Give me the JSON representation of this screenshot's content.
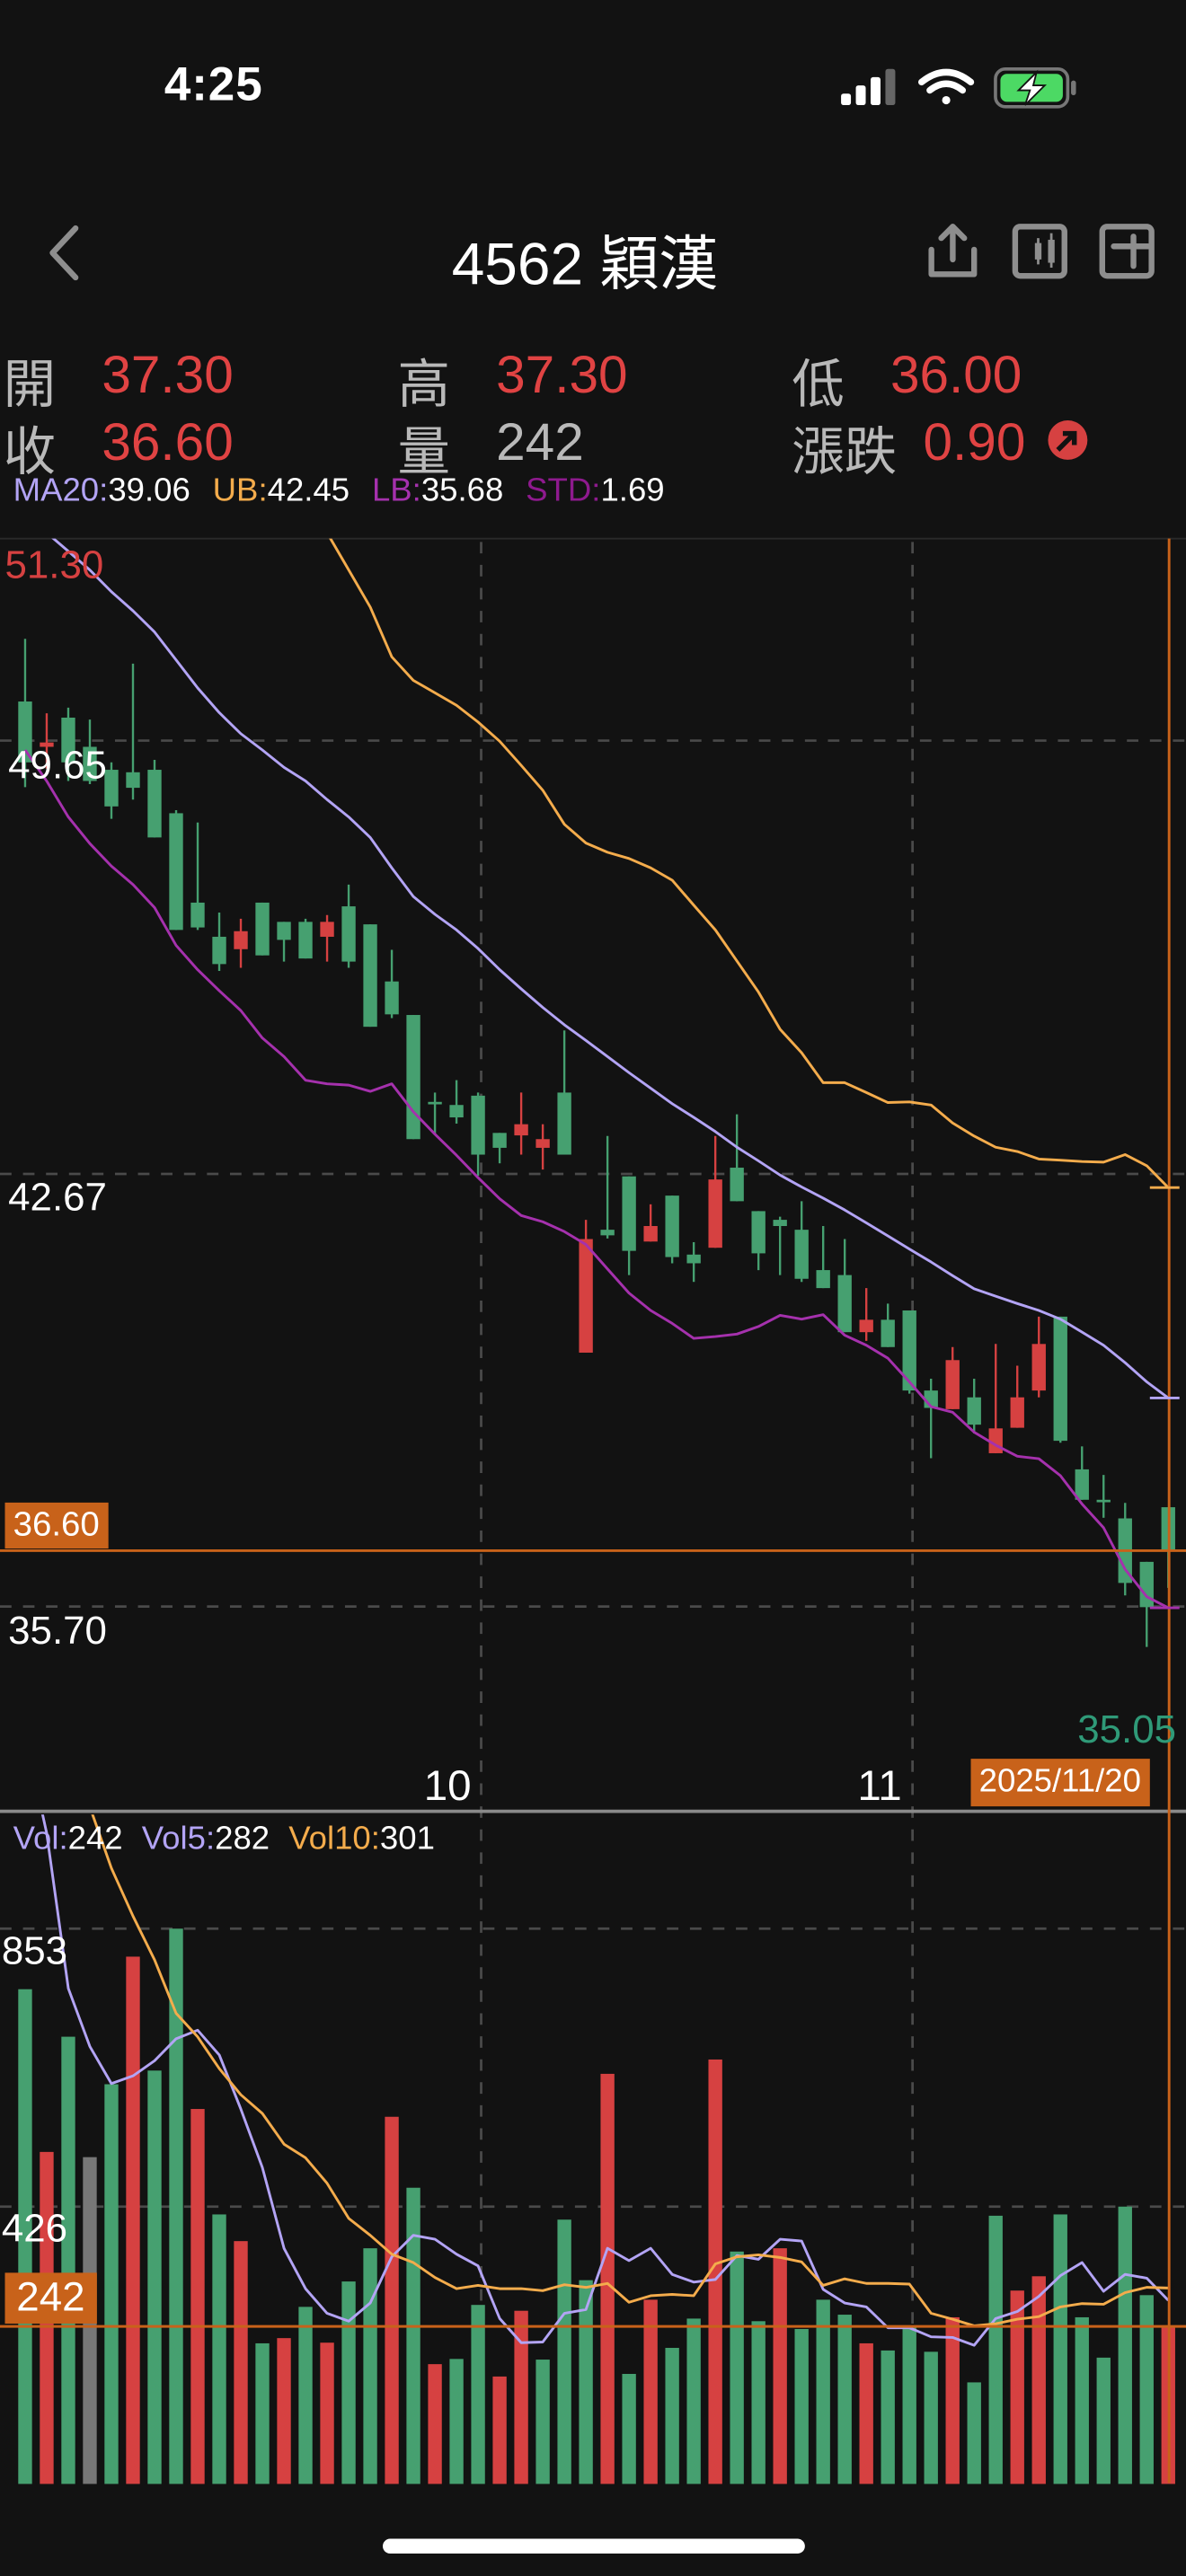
{
  "status_bar": {
    "time": "4:25"
  },
  "nav": {
    "title": "4562 穎漢",
    "back_icon": "chevron-left-icon",
    "icons": [
      "share-icon",
      "candlestick-icon",
      "crosshair-box-icon"
    ]
  },
  "quote": {
    "open_label": "開",
    "open": "37.30",
    "high_label": "高",
    "high": "37.30",
    "low_label": "低",
    "low": "36.00",
    "close_label": "收",
    "close": "36.60",
    "volume_label": "量",
    "volume": "242",
    "change_label": "漲跌",
    "change": "0.90"
  },
  "indicators": {
    "ma20_label": "MA20:",
    "ma20": "39.06",
    "ub_label": "UB:",
    "ub": "42.45",
    "lb_label": "LB:",
    "lb": "35.68",
    "std_label": "STD:",
    "std": "1.69"
  },
  "price_axis": {
    "max_label": "51.30",
    "grid1": "49.65",
    "grid2": "42.67",
    "grid3": "35.70",
    "min_label": "35.05",
    "cursor_price": "36.60"
  },
  "x_axis": {
    "tick1": "10",
    "tick2": "11",
    "cursor_date": "2025/11/20"
  },
  "volume_legend": {
    "vol_label": "Vol:",
    "vol": "242",
    "vol5_label": "Vol5:",
    "vol5": "282",
    "vol10_label": "Vol10:",
    "vol10": "301"
  },
  "volume_axis": {
    "grid1": "853",
    "grid2": "426",
    "cursor_vol": "242"
  },
  "colors": {
    "up": "#d64141",
    "down": "#46a070",
    "flat": "#777777",
    "ma20": "#b3a4f5",
    "ub": "#f4ac4c",
    "lb": "#a531ad",
    "std": "#8e1a8e",
    "cursor": "#c8621a",
    "grid": "#4a4a4a"
  },
  "chart_data": {
    "type": "candlestick",
    "price_range": [
      35.05,
      51.3
    ],
    "price_gridlines": [
      49.65,
      42.67,
      35.7
    ],
    "x_ticks": [
      {
        "index": 20,
        "label": "10"
      },
      {
        "index": 40,
        "label": "11"
      }
    ],
    "ohlc": [
      [
        50.28,
        51.29,
        48.9,
        49.3
      ],
      [
        49.55,
        50.09,
        49.2,
        49.62
      ],
      [
        50.02,
        50.18,
        49.0,
        49.3
      ],
      [
        49.55,
        49.99,
        48.95,
        49.0
      ],
      [
        49.18,
        49.3,
        48.39,
        48.59
      ],
      [
        49.14,
        50.89,
        48.7,
        48.89
      ],
      [
        49.18,
        49.34,
        48.09,
        48.09
      ],
      [
        48.48,
        48.53,
        46.6,
        46.6
      ],
      [
        47.04,
        48.33,
        46.6,
        46.64
      ],
      [
        46.49,
        46.88,
        45.94,
        46.05
      ],
      [
        46.29,
        46.78,
        45.99,
        46.58
      ],
      [
        47.04,
        47.04,
        46.19,
        46.19
      ],
      [
        46.73,
        46.73,
        46.09,
        46.44
      ],
      [
        46.73,
        46.78,
        46.14,
        46.14
      ],
      [
        46.49,
        46.84,
        46.09,
        46.73
      ],
      [
        46.98,
        47.33,
        45.99,
        46.09
      ],
      [
        46.69,
        46.69,
        45.04,
        45.04
      ],
      [
        45.77,
        46.28,
        45.18,
        45.24
      ],
      [
        45.23,
        45.23,
        43.23,
        43.23
      ],
      [
        43.83,
        43.98,
        43.31,
        43.8
      ],
      [
        43.78,
        44.18,
        43.48,
        43.58
      ],
      [
        43.93,
        43.98,
        42.64,
        42.98
      ],
      [
        43.33,
        43.33,
        42.84,
        43.09
      ],
      [
        43.29,
        43.98,
        42.98,
        43.47
      ],
      [
        43.09,
        43.47,
        42.74,
        43.23
      ],
      [
        43.98,
        44.98,
        42.98,
        42.98
      ],
      [
        39.79,
        41.93,
        39.79,
        41.62
      ],
      [
        41.77,
        43.28,
        41.63,
        41.68
      ],
      [
        42.63,
        42.63,
        41.04,
        41.43
      ],
      [
        41.58,
        42.18,
        41.58,
        41.83
      ],
      [
        42.32,
        42.32,
        41.23,
        41.33
      ],
      [
        41.37,
        41.57,
        40.93,
        41.23
      ],
      [
        41.48,
        43.28,
        41.48,
        42.58
      ],
      [
        42.77,
        43.63,
        42.23,
        42.23
      ],
      [
        42.07,
        42.07,
        41.12,
        41.39
      ],
      [
        41.93,
        41.98,
        41.04,
        41.83
      ],
      [
        41.77,
        42.23,
        40.93,
        40.98
      ],
      [
        41.12,
        41.83,
        40.83,
        40.83
      ],
      [
        41.04,
        41.62,
        40.12,
        40.12
      ],
      [
        40.12,
        40.83,
        39.98,
        40.32
      ],
      [
        40.32,
        40.58,
        39.88,
        39.88
      ],
      [
        40.47,
        40.47,
        39.13,
        39.18
      ],
      [
        39.18,
        39.37,
        38.09,
        38.9
      ],
      [
        38.88,
        39.88,
        38.88,
        39.67
      ],
      [
        39.07,
        39.37,
        38.49,
        38.63
      ],
      [
        38.17,
        39.93,
        38.17,
        38.57
      ],
      [
        38.58,
        39.58,
        38.58,
        39.07
      ],
      [
        39.18,
        40.37,
        39.07,
        39.93
      ],
      [
        40.37,
        40.37,
        38.34,
        38.37
      ],
      [
        37.91,
        38.28,
        37.42,
        37.42
      ],
      [
        37.42,
        37.82,
        37.13,
        37.39
      ],
      [
        37.12,
        37.37,
        35.88,
        36.08
      ],
      [
        36.42,
        36.42,
        35.05,
        35.69
      ],
      [
        37.3,
        37.3,
        36.0,
        36.6
      ]
    ],
    "ma20": [
      53.3,
      53.0,
      52.7,
      52.4,
      52.05,
      51.74,
      51.4,
      50.95,
      50.5,
      50.1,
      49.76,
      49.5,
      49.22,
      49.0,
      48.7,
      48.42,
      48.09,
      47.6,
      47.14,
      46.85,
      46.6,
      46.3,
      45.96,
      45.65,
      45.35,
      45.07,
      44.82,
      44.56,
      44.3,
      44.05,
      43.8,
      43.58,
      43.35,
      43.1,
      42.88,
      42.65,
      42.46,
      42.28,
      42.09,
      41.88,
      41.67,
      41.46,
      41.25,
      41.03,
      40.82,
      40.7,
      40.58,
      40.47,
      40.33,
      40.12,
      39.91,
      39.63,
      39.32,
      39.06
    ],
    "ub": [
      null,
      null,
      null,
      null,
      null,
      null,
      null,
      null,
      null,
      null,
      null,
      null,
      null,
      null,
      53.0,
      52.4,
      51.8,
      51.0,
      50.62,
      50.42,
      50.22,
      49.95,
      49.64,
      49.25,
      48.85,
      48.3,
      48.0,
      47.85,
      47.75,
      47.6,
      47.4,
      47.0,
      46.6,
      46.1,
      45.6,
      45.0,
      44.62,
      44.14,
      44.14,
      43.98,
      43.82,
      43.83,
      43.78,
      43.49,
      43.28,
      43.1,
      43.03,
      42.91,
      42.89,
      42.87,
      42.86,
      42.98,
      42.8,
      42.45
    ],
    "lb": [
      49.5,
      49.0,
      48.42,
      47.99,
      47.63,
      47.33,
      46.96,
      46.35,
      45.96,
      45.62,
      45.3,
      44.86,
      44.56,
      44.18,
      44.12,
      44.1,
      44.0,
      44.12,
      43.67,
      43.31,
      42.97,
      42.61,
      42.27,
      42.0,
      41.9,
      41.74,
      41.53,
      41.14,
      40.75,
      40.47,
      40.26,
      40.02,
      40.05,
      40.09,
      40.21,
      40.39,
      40.33,
      40.4,
      40.07,
      39.91,
      39.7,
      39.32,
      38.92,
      38.83,
      38.51,
      38.3,
      38.12,
      38.08,
      37.81,
      37.35,
      36.97,
      36.3,
      35.86,
      35.68
    ],
    "volume_range": [
      0,
      1028
    ],
    "volume_gridlines": [
      853,
      426
    ],
    "volume": [
      760,
      510,
      687,
      502,
      614,
      810,
      635,
      853,
      576,
      414,
      373,
      216,
      224,
      272,
      217,
      311,
      362,
      564,
      455,
      184,
      192,
      275,
      165,
      266,
      191,
      406,
      313,
      630,
      169,
      283,
      209,
      254,
      652,
      357,
      250,
      362,
      238,
      283,
      260,
      216,
      205,
      243,
      203,
      256,
      156,
      412,
      297,
      319,
      414,
      256,
      194,
      426,
      290,
      242
    ],
    "volume_direction": "GRGNGRGGRGRGRGRGGRGRGGRRGGGRGRGGRGGRGGGRGGGRGGRRGGGGGR",
    "vol5": [
      1150,
      1000,
      761,
      672,
      615,
      627,
      650,
      684,
      697,
      659,
      576,
      486,
      362,
      300,
      262,
      250,
      278,
      349,
      382,
      376,
      353,
      335,
      254,
      217,
      218,
      262,
      268,
      362,
      343,
      362,
      322,
      310,
      314,
      351,
      345,
      376,
      373,
      299,
      278,
      272,
      240,
      240,
      226,
      225,
      213,
      254,
      265,
      288,
      320,
      340,
      296,
      322,
      316,
      282
    ],
    "vol10": [
      null,
      null,
      null,
      1040,
      946,
      872,
      805,
      723,
      687,
      638,
      598,
      569,
      522,
      501,
      462,
      408,
      382,
      353,
      340,
      317,
      300,
      305,
      300,
      300,
      297,
      306,
      302,
      308,
      279,
      289,
      291,
      289,
      338,
      349,
      352,
      348,
      341,
      305,
      315,
      308,
      308,
      307,
      262,
      253,
      243,
      246,
      253,
      257,
      272,
      277,
      276,
      294,
      302,
      301
    ],
    "cursor_index": 53
  }
}
